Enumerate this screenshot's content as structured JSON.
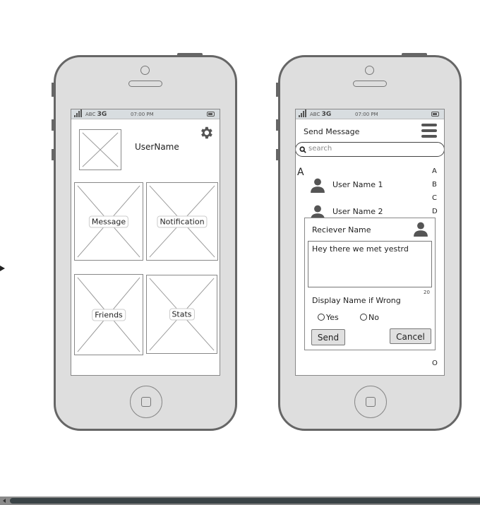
{
  "left_phone": {
    "status": {
      "carrier": "ABC",
      "network": "3G",
      "time": "07:00 PM"
    },
    "username": "UserName",
    "tiles": [
      {
        "label": "Message"
      },
      {
        "label": "Notification"
      },
      {
        "label": "Friends"
      },
      {
        "label": "Stats"
      }
    ],
    "icons": {
      "settings": "gear-icon"
    }
  },
  "right_phone": {
    "status": {
      "carrier": "ABC",
      "network": "3G",
      "time": "07:00 PM"
    },
    "title": "Send Message",
    "search": {
      "placeholder": "search",
      "value": ""
    },
    "section_letter": "A",
    "contacts": [
      {
        "name": "User Name 1"
      },
      {
        "name": "User Name 2"
      }
    ],
    "index_letters": [
      "A",
      "B",
      "C",
      "D",
      "O"
    ],
    "dialog": {
      "receiver_label": "Reciever Name",
      "message_value": "Hey there we met yestrd",
      "char_count": "20",
      "display_name_label": "Display Name if Wrong",
      "radio_yes": "Yes",
      "radio_no": "No",
      "send_label": "Send",
      "cancel_label": "Cancel"
    },
    "icons": {
      "menu": "hamburger-menu-icon",
      "search": "search-icon",
      "user": "user-icon"
    }
  },
  "colors": {
    "phone_body": "#dedede",
    "phone_border": "#666666",
    "statusbar": "#d8dde0",
    "scrollbar_thumb": "#3a4346"
  }
}
